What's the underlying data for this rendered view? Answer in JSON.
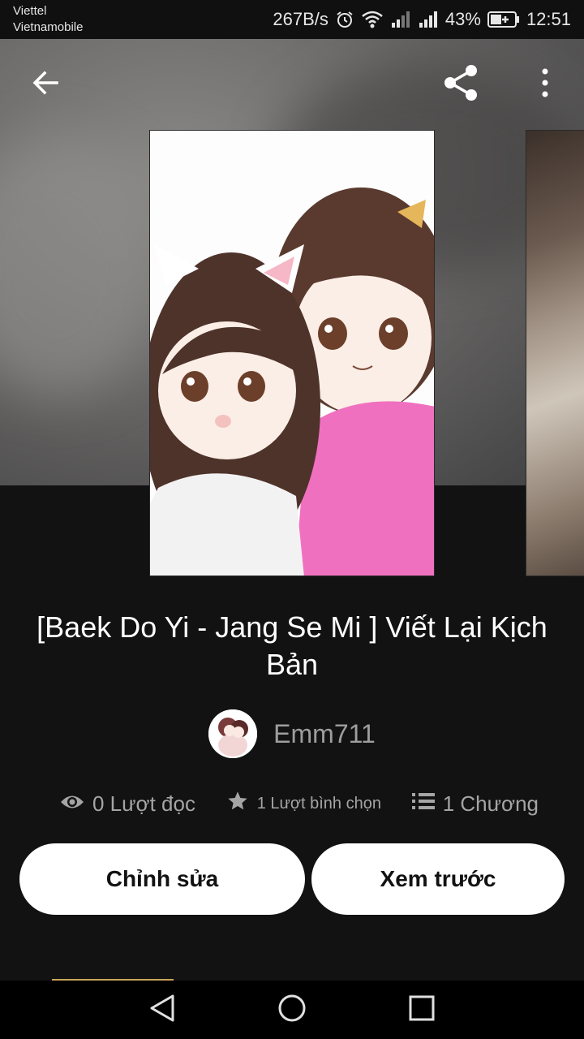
{
  "status_bar": {
    "carrier_1": "Viettel",
    "carrier_2": "Vietnamobile",
    "net_speed": "267B/s",
    "battery": "43%",
    "time": "12:51"
  },
  "toolbar": {
    "back_icon": "arrow-left-icon",
    "share_icon": "share-icon",
    "more_icon": "more-vertical-icon"
  },
  "story": {
    "title": "[Baek Do Yi - Jang Se Mi ] Viết Lại Kịch Bản",
    "author": "Emm711",
    "stats": {
      "reads": "0 Lượt đọc",
      "votes": "1 Lượt bình chọn",
      "chapters": "1 Chương"
    }
  },
  "actions": {
    "edit_label": "Chỉnh sửa",
    "preview_label": "Xem trước"
  },
  "colors": {
    "background": "#121212",
    "button_bg": "#ffffff",
    "button_text": "#121212",
    "muted_text": "#a5a5a5",
    "accent_line": "#c8a45a"
  },
  "nav_bar": {
    "back_icon": "triangle-back-icon",
    "home_icon": "circle-home-icon",
    "recents_icon": "square-recents-icon"
  }
}
